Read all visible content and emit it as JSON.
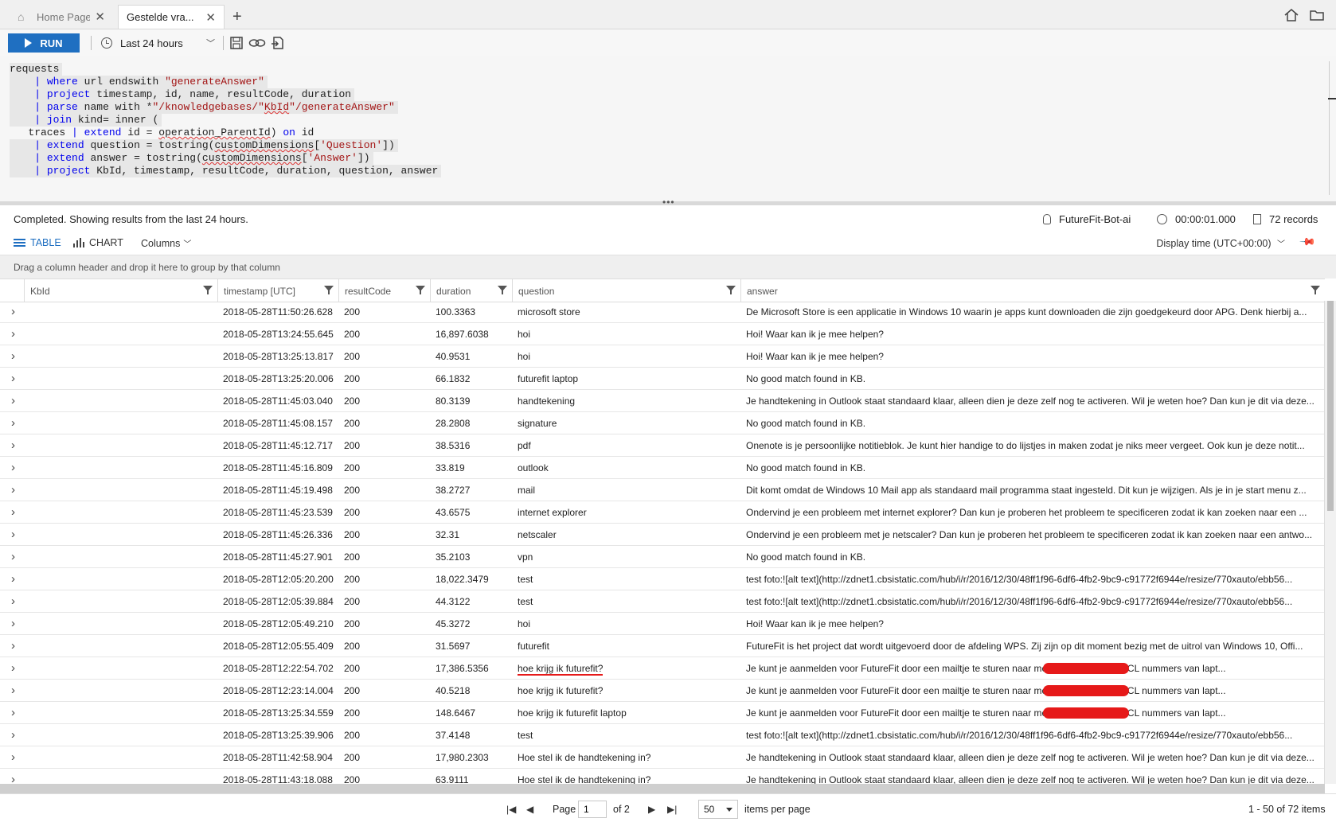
{
  "tabs": [
    {
      "label": "Home Page",
      "icon": "home-icon"
    },
    {
      "label": "Gestelde vra..."
    }
  ],
  "toolbar": {
    "run_label": "RUN",
    "time_range": "Last 24 hours"
  },
  "query": {
    "lines": [
      "requests",
      "| where url endswith \"generateAnswer\"",
      "| project timestamp, id, name, resultCode, duration",
      "| parse name with *\"/knowledgebases/\"KbId\"/generateAnswer\"",
      "| join kind= inner (",
      "traces | extend id = operation_ParentId) on id",
      "| extend question = tostring(customDimensions['Question'])",
      "| extend answer = tostring(customDimensions['Answer'])",
      "| project KbId, timestamp, resultCode, duration, question, answer"
    ]
  },
  "status": {
    "message": "Completed. Showing results from the last 24 hours.",
    "resource": "FutureFit-Bot-ai",
    "elapsed": "00:00:01.000",
    "records": "72 records"
  },
  "view": {
    "table_label": "TABLE",
    "chart_label": "CHART",
    "columns_label": "Columns",
    "display_time": "Display time (UTC+00:00)",
    "group_hint": "Drag a column header and drop it here to group by that column"
  },
  "grid": {
    "columns": [
      "KbId",
      "timestamp [UTC]",
      "resultCode",
      "duration",
      "question",
      "answer"
    ],
    "rows": [
      {
        "timestamp": "2018-05-28T11:50:26.628",
        "resultCode": "200",
        "duration": "100.3363",
        "question": "microsoft store",
        "answer": "De Microsoft Store is een applicatie in Windows 10 waarin je apps kunt downloaden die zijn goedgekeurd door APG. Denk hierbij a..."
      },
      {
        "timestamp": "2018-05-28T13:24:55.645",
        "resultCode": "200",
        "duration": "16,897.6038",
        "question": "hoi",
        "answer": "Hoi! Waar kan ik je mee helpen?"
      },
      {
        "timestamp": "2018-05-28T13:25:13.817",
        "resultCode": "200",
        "duration": "40.9531",
        "question": "hoi",
        "answer": "Hoi! Waar kan ik je mee helpen?"
      },
      {
        "timestamp": "2018-05-28T13:25:20.006",
        "resultCode": "200",
        "duration": "66.1832",
        "question": "futurefit laptop",
        "answer": "No good match found in KB."
      },
      {
        "timestamp": "2018-05-28T11:45:03.040",
        "resultCode": "200",
        "duration": "80.3139",
        "question": "handtekening",
        "answer": "Je handtekening in Outlook staat standaard klaar, alleen dien je deze zelf nog te activeren. Wil je weten hoe? Dan kun je dit via deze..."
      },
      {
        "timestamp": "2018-05-28T11:45:08.157",
        "resultCode": "200",
        "duration": "28.2808",
        "question": "signature",
        "answer": "No good match found in KB."
      },
      {
        "timestamp": "2018-05-28T11:45:12.717",
        "resultCode": "200",
        "duration": "38.5316",
        "question": "pdf",
        "answer": "Onenote is je persoonlijke notitieblok. Je kunt hier handige to do lijstjes in maken zodat je niks meer vergeet. Ook kun je deze notit..."
      },
      {
        "timestamp": "2018-05-28T11:45:16.809",
        "resultCode": "200",
        "duration": "33.819",
        "question": "outlook",
        "answer": "No good match found in KB."
      },
      {
        "timestamp": "2018-05-28T11:45:19.498",
        "resultCode": "200",
        "duration": "38.2727",
        "question": "mail",
        "answer": "Dit komt omdat de Windows 10 Mail app als standaard mail programma staat ingesteld. Dit kun je wijzigen. Als je in je start menu z..."
      },
      {
        "timestamp": "2018-05-28T11:45:23.539",
        "resultCode": "200",
        "duration": "43.6575",
        "question": "internet explorer",
        "answer": "Ondervind je een probleem met internet explorer? Dan kun je proberen het probleem te specificeren zodat ik kan zoeken naar een ..."
      },
      {
        "timestamp": "2018-05-28T11:45:26.336",
        "resultCode": "200",
        "duration": "32.31",
        "question": "netscaler",
        "answer": "Ondervind je een probleem met je netscaler? Dan kun je proberen het probleem te specificeren zodat ik kan zoeken naar een antwo..."
      },
      {
        "timestamp": "2018-05-28T11:45:27.901",
        "resultCode": "200",
        "duration": "35.2103",
        "question": "vpn",
        "answer": "No good match found in KB."
      },
      {
        "timestamp": "2018-05-28T12:05:20.200",
        "resultCode": "200",
        "duration": "18,022.3479",
        "question": "test",
        "answer": "test foto:![alt text](http://zdnet1.cbsistatic.com/hub/i/r/2016/12/30/48ff1f96-6df6-4fb2-9bc9-c91772f6944e/resize/770xauto/ebb56..."
      },
      {
        "timestamp": "2018-05-28T12:05:39.884",
        "resultCode": "200",
        "duration": "44.3122",
        "question": "test",
        "answer": "test foto:![alt text](http://zdnet1.cbsistatic.com/hub/i/r/2016/12/30/48ff1f96-6df6-4fb2-9bc9-c91772f6944e/resize/770xauto/ebb56..."
      },
      {
        "timestamp": "2018-05-28T12:05:49.210",
        "resultCode": "200",
        "duration": "45.3272",
        "question": "hoi",
        "answer": "Hoi! Waar kan ik je mee helpen?"
      },
      {
        "timestamp": "2018-05-28T12:05:55.409",
        "resultCode": "200",
        "duration": "31.5697",
        "question": "futurefit",
        "answer": "FutureFit is het project dat wordt uitgevoerd door de afdeling WPS. Zij zijn op dit moment bezig met de uitrol van Windows 10, Offi..."
      },
      {
        "timestamp": "2018-05-28T12:22:54.702",
        "resultCode": "200",
        "duration": "17,386.5356",
        "question": "hoe krijg ik futurefit?",
        "answer": "Je kunt je aanmelden voor FutureFit door een mailtje te sturen naar                              met je username en PCL nummers van lapt...",
        "redacted": true,
        "underline": true
      },
      {
        "timestamp": "2018-05-28T12:23:14.004",
        "resultCode": "200",
        "duration": "40.5218",
        "question": "hoe krijg ik futurefit?",
        "answer": "Je kunt je aanmelden voor FutureFit door een mailtje te sturen naar                              met je username en PCL nummers van lapt...",
        "redacted": true
      },
      {
        "timestamp": "2018-05-28T13:25:34.559",
        "resultCode": "200",
        "duration": "148.6467",
        "question": "hoe krijg ik futurefit laptop",
        "answer": "Je kunt je aanmelden voor FutureFit door een mailtje te sturen naar                              met je username en PCL nummers van lapt...",
        "redacted": true
      },
      {
        "timestamp": "2018-05-28T13:25:39.906",
        "resultCode": "200",
        "duration": "37.4148",
        "question": "test",
        "answer": "test foto:![alt text](http://zdnet1.cbsistatic.com/hub/i/r/2016/12/30/48ff1f96-6df6-4fb2-9bc9-c91772f6944e/resize/770xauto/ebb56..."
      },
      {
        "timestamp": "2018-05-28T11:42:58.904",
        "resultCode": "200",
        "duration": "17,980.2303",
        "question": "Hoe stel ik de handtekening in?",
        "answer": "Je handtekening in Outlook staat standaard klaar, alleen dien je deze zelf nog te activeren. Wil je weten hoe? Dan kun je dit via deze..."
      },
      {
        "timestamp": "2018-05-28T11:43:18.088",
        "resultCode": "200",
        "duration": "63.9111",
        "question": "Hoe stel ik de handtekening in?",
        "answer": "Je handtekening in Outlook staat standaard klaar, alleen dien je deze zelf nog te activeren. Wil je weten hoe? Dan kun je dit via deze..."
      }
    ]
  },
  "pager": {
    "page_label": "Page",
    "page_value": "1",
    "of_label": "of 2",
    "page_size": "50",
    "items_label": "items per page",
    "range_label": "1 - 50 of 72 items"
  },
  "colors": {
    "accent": "#1f6fc1",
    "redaction": "#e61919"
  }
}
